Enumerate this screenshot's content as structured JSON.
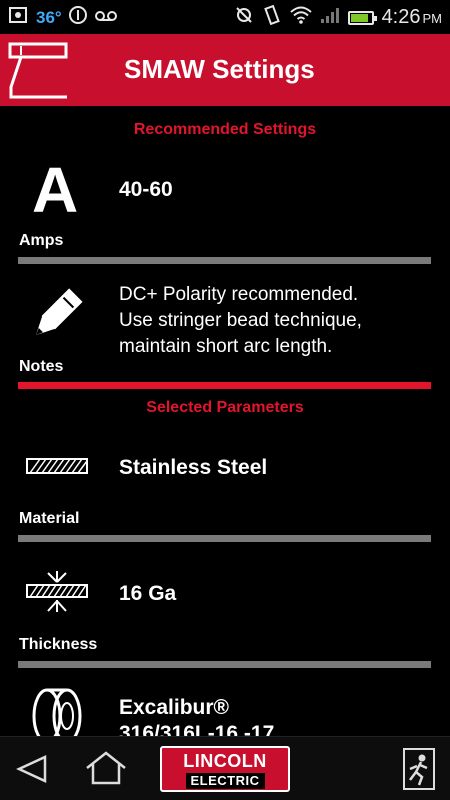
{
  "status_bar": {
    "temperature": "36°",
    "time": "4:26",
    "ampm": "PM",
    "battery_level": 0.85
  },
  "header": {
    "title": "SMAW Settings",
    "logo_icon": "welding-gun-icon",
    "brand_color": "#c8102e"
  },
  "recommended": {
    "section_title": "Recommended Settings",
    "amps": {
      "icon_letter": "A",
      "label": "Amps",
      "value": "40-60"
    },
    "notes": {
      "label": "Notes",
      "lines": [
        "DC+ Polarity recommended.",
        "Use stringer bead technique,",
        "maintain short arc length."
      ]
    }
  },
  "selected": {
    "section_title": "Selected Parameters",
    "material": {
      "label": "Material",
      "value": "Stainless Steel",
      "icon": "material-hatch-icon"
    },
    "thickness": {
      "label": "Thickness",
      "value": "16 Ga",
      "icon": "thickness-icon"
    },
    "electrode": {
      "value_line1": "Excalibur®",
      "value_line2": "316/316L-16,-17",
      "icon": "wire-spool-icon"
    }
  },
  "nav": {
    "back_icon": "back-icon",
    "home_icon": "home-icon",
    "brand_line1": "LINCOLN",
    "brand_line2": "ELECTRIC",
    "exit_icon": "exit-icon"
  },
  "colors": {
    "accent_red": "#e3152c",
    "divider_gray": "#7a7a7a",
    "background": "#000000"
  }
}
